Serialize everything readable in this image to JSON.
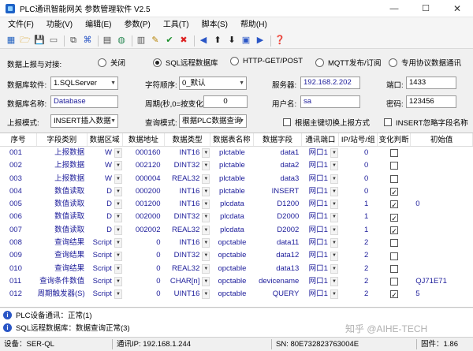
{
  "window": {
    "title": "PLC通讯智能网关 参数管理软件 V2.5",
    "min": "—",
    "max": "☐",
    "close": "✕"
  },
  "menu": [
    "文件(F)",
    "功能(V)",
    "编辑(E)",
    "参数(P)",
    "工具(T)",
    "脚本(S)",
    "帮助(H)"
  ],
  "toolbar_icons": [
    "grid-icon",
    "open-folder-icon",
    "save-icon",
    "blank-icon",
    "sep",
    "copy-icon",
    "network-icon",
    "sep",
    "doc-icon",
    "globe-icon",
    "sep",
    "scan-icon",
    "edit-icon",
    "check-icon",
    "delete-icon",
    "sep",
    "arrow-left-icon",
    "arrow-up-icon",
    "arrow-down-icon",
    "ok-icon",
    "arrow-right-icon",
    "sep",
    "help-icon"
  ],
  "config": {
    "upload_label": "数据上报与对接:",
    "modes": [
      {
        "label": "关闭",
        "selected": false
      },
      {
        "label": "SQL远程数据库",
        "selected": true
      },
      {
        "label": "HTTP-GET/POST",
        "selected": false
      },
      {
        "label": "MQTT发布/订阅",
        "selected": false
      },
      {
        "label": "专用协议数据通讯",
        "selected": false
      }
    ],
    "db_software_label": "数据库软件:",
    "db_software_value": "1.SQLServer",
    "char_order_label": "字符顺序:",
    "char_order_value": "0_默认",
    "server_label": "服务器:",
    "server_value": "192.168.2.202",
    "port_label": "端口:",
    "port_value": "1433",
    "db_name_label": "数据库名称:",
    "db_name_value": "Database",
    "period_label": "周期(秒,0=按变化):",
    "period_value": "0",
    "user_label": "用户名:",
    "user_value": "sa",
    "password_label": "密码:",
    "password_value": "123456",
    "upload_mode_label": "上报模式:",
    "upload_mode_value": "INSERT插入数据",
    "query_mode_label": "查询模式:",
    "query_mode_value": "根据PLC数据查询",
    "chk1_label": "根据主键切换上报方式",
    "chk2_label": "INSERT忽略字段名称"
  },
  "table": {
    "headers": [
      "序号",
      "字段类别",
      "数据区域",
      "数据地址",
      "数据类型",
      "数据表名称",
      "数据字段",
      "通讯端口",
      "IP/站号/组",
      "变化判断",
      "初始值"
    ],
    "rows": [
      {
        "no": "001",
        "cat": "上报数据",
        "area": "W",
        "addr": "000160",
        "type": "INT16",
        "table": "plctable",
        "field": "data1",
        "port": "网口1",
        "ip": "0",
        "chg": false,
        "init": ""
      },
      {
        "no": "002",
        "cat": "上报数据",
        "area": "W",
        "addr": "002120",
        "type": "DINT32",
        "table": "plctable",
        "field": "data2",
        "port": "网口1",
        "ip": "0",
        "chg": false,
        "init": ""
      },
      {
        "no": "003",
        "cat": "上报数据",
        "area": "W",
        "addr": "000004",
        "type": "REAL32",
        "table": "plctable",
        "field": "data3",
        "port": "网口1",
        "ip": "0",
        "chg": false,
        "init": ""
      },
      {
        "no": "004",
        "cat": "数值读取",
        "area": "D",
        "addr": "000200",
        "type": "INT16",
        "table": "plctable",
        "field": "INSERT",
        "port": "网口1",
        "ip": "0",
        "chg": true,
        "init": ""
      },
      {
        "no": "005",
        "cat": "数值读取",
        "area": "D",
        "addr": "001200",
        "type": "INT16",
        "table": "plcdata",
        "field": "D1200",
        "port": "网口1",
        "ip": "1",
        "chg": true,
        "init": "0"
      },
      {
        "no": "006",
        "cat": "数值读取",
        "area": "D",
        "addr": "002000",
        "type": "DINT32",
        "table": "plcdata",
        "field": "D2000",
        "port": "网口1",
        "ip": "1",
        "chg": true,
        "init": ""
      },
      {
        "no": "007",
        "cat": "数值读取",
        "area": "D",
        "addr": "002002",
        "type": "REAL32",
        "table": "plcdata",
        "field": "D2002",
        "port": "网口1",
        "ip": "1",
        "chg": true,
        "init": ""
      },
      {
        "no": "008",
        "cat": "查询结果",
        "area": "Script",
        "addr": "0",
        "type": "INT16",
        "table": "opctable",
        "field": "data11",
        "port": "网口1",
        "ip": "2",
        "chg": false,
        "init": ""
      },
      {
        "no": "009",
        "cat": "查询结果",
        "area": "Script",
        "addr": "0",
        "type": "DINT32",
        "table": "opctable",
        "field": "data12",
        "port": "网口1",
        "ip": "2",
        "chg": false,
        "init": ""
      },
      {
        "no": "010",
        "cat": "查询结果",
        "area": "Script",
        "addr": "0",
        "type": "REAL32",
        "table": "opctable",
        "field": "data13",
        "port": "网口1",
        "ip": "2",
        "chg": false,
        "init": ""
      },
      {
        "no": "011",
        "cat": "查询条件数值",
        "area": "Script",
        "addr": "0",
        "type": "CHAR[n]",
        "table": "opctable",
        "field": "devicename",
        "port": "网口1",
        "ip": "2",
        "chg": false,
        "init": "QJ71E71"
      },
      {
        "no": "012",
        "cat": "周期触发器(S)",
        "area": "Script",
        "addr": "0",
        "type": "UINT16",
        "table": "opctable",
        "field": "QUERY",
        "port": "网口1",
        "ip": "2",
        "chg": true,
        "init": "5"
      }
    ]
  },
  "log": [
    "PLC设备通讯：正常(1)",
    "SQL远程数据库：数据查询正常(3)"
  ],
  "watermark": "知乎 @AIHE-TECH",
  "status": {
    "device": "设备：SER-QL",
    "ip": "通讯IP: 192.168.1.244",
    "sn": "SN: 80E732823763004E",
    "firmware": "固件：1.86"
  }
}
